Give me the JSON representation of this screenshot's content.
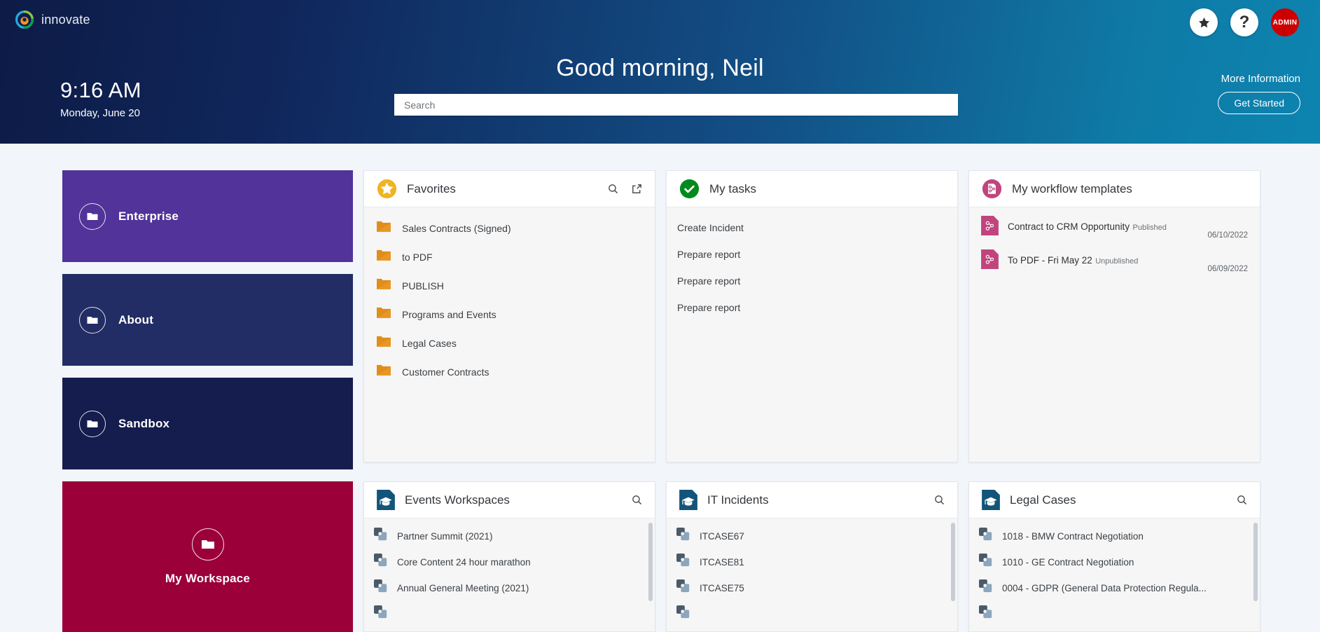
{
  "header": {
    "brand": "innovate",
    "logo_icon": "innovate-swirl-logo",
    "time": "9:16 AM",
    "date": "Monday, June 20",
    "greeting": "Good morning, Neil",
    "search": {
      "value": "",
      "placeholder": "Search"
    },
    "favorites_icon": "star-icon",
    "help_icon": "question-mark-icon",
    "help_glyph": "?",
    "avatar_initials": "ADMIN",
    "more_information_label": "More Information",
    "get_started_label": "Get Started"
  },
  "colors": {
    "header_gradient_start": "#0d1b46",
    "header_gradient_end": "#0d84b0",
    "enterprise_tile": "#513399",
    "about_tile": "#222d65",
    "sandbox_tile": "#151c4e",
    "my_workspace_tile": "#9b0038",
    "avatar_red": "#cc0000",
    "favorites_star": "#f0b323",
    "tasks_green": "#008a1e",
    "workflow_pink": "#c0457e",
    "folder_orange": "#e08d1a",
    "workspace_icon_blue": "#13547a",
    "page_bg": "#f2f5fa"
  },
  "tiles": [
    {
      "label": "Enterprise",
      "icon": "folder-icon",
      "color": "#513399"
    },
    {
      "label": "About",
      "icon": "folder-icon",
      "color": "#222d65"
    },
    {
      "label": "Sandbox",
      "icon": "folder-icon",
      "color": "#151c4e"
    }
  ],
  "my_workspace": {
    "label": "My Workspace",
    "icon": "folder-icon",
    "color": "#9b0038"
  },
  "cards": {
    "favorites": {
      "title": "Favorites",
      "icon": "star-icon",
      "actions": [
        "search-icon",
        "external-link-icon"
      ],
      "items": [
        {
          "label": "Sales Contracts (Signed)",
          "icon": "folder-icon"
        },
        {
          "label": "to PDF",
          "icon": "folder-icon"
        },
        {
          "label": "PUBLISH",
          "icon": "folder-icon"
        },
        {
          "label": "Programs and Events",
          "icon": "folder-icon"
        },
        {
          "label": "Legal Cases",
          "icon": "folder-icon"
        },
        {
          "label": "Customer Contracts",
          "icon": "folder-icon"
        }
      ]
    },
    "my_tasks": {
      "title": "My tasks",
      "icon": "check-circle-icon",
      "items": [
        {
          "label": "Create Incident"
        },
        {
          "label": "Prepare report"
        },
        {
          "label": "Prepare report"
        },
        {
          "label": "Prepare report"
        }
      ]
    },
    "my_workflow_templates": {
      "title": "My workflow templates",
      "icon": "workflow-icon",
      "items": [
        {
          "name": "Contract to CRM Opportunity",
          "status": "Published",
          "date": "06/10/2022",
          "icon": "workflow-doc-icon"
        },
        {
          "name": "To PDF - Fri May 22",
          "status": "Unpublished",
          "date": "06/09/2022",
          "icon": "workflow-doc-icon"
        }
      ]
    },
    "events_workspaces": {
      "title": "Events Workspaces",
      "icon": "workspace-doc-icon",
      "actions": [
        "search-icon"
      ],
      "items": [
        {
          "label": "Partner Summit (2021)",
          "icon": "workspace-stack-icon"
        },
        {
          "label": "Core Content 24 hour marathon",
          "icon": "workspace-stack-icon"
        },
        {
          "label": "Annual General Meeting (2021)",
          "icon": "workspace-stack-icon"
        },
        {
          "label": "",
          "icon": "workspace-stack-icon"
        }
      ]
    },
    "it_incidents": {
      "title": "IT Incidents",
      "icon": "workspace-doc-icon",
      "actions": [
        "search-icon"
      ],
      "items": [
        {
          "label": "ITCASE67",
          "icon": "workspace-stack-icon"
        },
        {
          "label": "ITCASE81",
          "icon": "workspace-stack-icon"
        },
        {
          "label": "ITCASE75",
          "icon": "workspace-stack-icon"
        },
        {
          "label": "",
          "icon": "workspace-stack-icon"
        }
      ]
    },
    "legal_cases": {
      "title": "Legal Cases",
      "icon": "workspace-doc-icon",
      "actions": [
        "search-icon"
      ],
      "items": [
        {
          "label": "1018 - BMW Contract Negotiation",
          "icon": "workspace-stack-icon"
        },
        {
          "label": "1010 - GE Contract Negotiation",
          "icon": "workspace-stack-icon"
        },
        {
          "label": "0004 - GDPR (General Data Protection Regula...",
          "icon": "workspace-stack-icon"
        },
        {
          "label": "",
          "icon": "workspace-stack-icon"
        }
      ]
    }
  }
}
